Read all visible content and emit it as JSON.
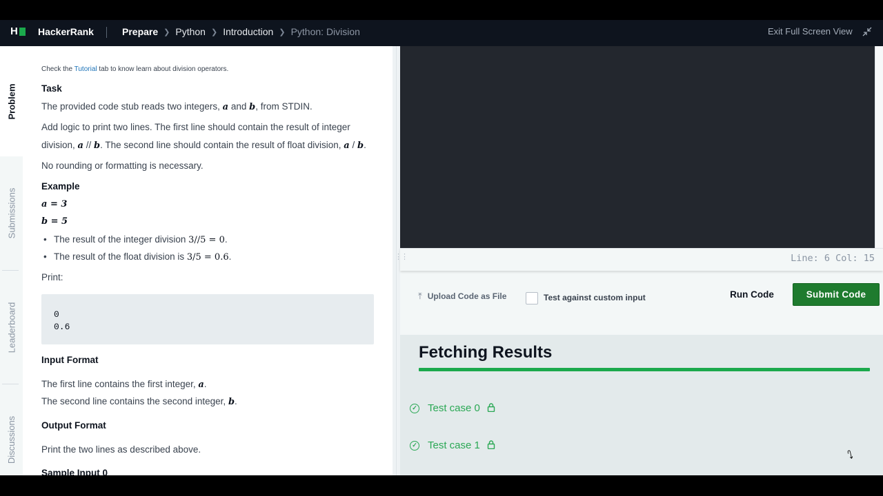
{
  "header": {
    "brand": "HackerRank",
    "breadcrumbs": [
      "Prepare",
      "Python",
      "Introduction",
      "Python: Division"
    ],
    "exit_fullscreen": "Exit Full Screen View",
    "icons": {
      "logo": "hackerrank-logo",
      "shrink": "shrink-icon",
      "chevron": "chevron-right-icon"
    }
  },
  "sidebar": {
    "tabs": [
      {
        "label": "Problem",
        "active": true
      },
      {
        "label": "Submissions",
        "active": false
      },
      {
        "label": "Leaderboard",
        "active": false
      },
      {
        "label": "Discussions",
        "active": false
      }
    ]
  },
  "problem": {
    "intro_pre": "Check the ",
    "intro_link": "Tutorial",
    "intro_post": " tab to know learn about division operators.",
    "task_heading": "Task",
    "task_p1_a": "The provided code stub reads two integers, ",
    "var_a": "a",
    "and": " and ",
    "var_b": "b",
    "task_p1_b": ", from STDIN.",
    "task_p2_line1": "Add logic to print two lines. The first line should contain the result of integer",
    "task_p2_line2_a": "division, ",
    "intdiv_op": " // ",
    "task_p2_line2_b": ". The second line should contain the result of float division, ",
    "floatdiv_op": " / ",
    "period": ".",
    "task_p3": "No rounding or formatting is necessary.",
    "example_heading": "Example",
    "example_a": "a = 3",
    "example_b": "b = 5",
    "bullet1_text": "The result of the integer division ",
    "bullet1_math": "3//5 = 0",
    "bullet2_text": "The result of the float division is ",
    "bullet2_math": "3/5 = 0.6",
    "print_label": "Print:",
    "output_line1": "0",
    "output_line2": "0.6",
    "input_format_heading": "Input Format",
    "input_line1": "The first line contains the first integer, ",
    "input_line2": "The second line contains the second integer, ",
    "output_format_heading": "Output Format",
    "output_format_text": "Print the two lines as described above.",
    "sample_input_heading": "Sample Input 0"
  },
  "editor": {
    "status": "Line: 6 Col: 15"
  },
  "actions": {
    "upload_label": "Upload Code as File",
    "custom_input_label": "Test against custom input",
    "custom_input_checked": false,
    "run_label": "Run Code",
    "submit_label": "Submit Code"
  },
  "results": {
    "heading": "Fetching Results",
    "progress_percent": 100,
    "test_cases": [
      {
        "label": "Test case 0",
        "status": "passed",
        "locked": true
      },
      {
        "label": "Test case 1",
        "status": "passed",
        "locked": true
      }
    ]
  },
  "colors": {
    "topbar": "#0e141e",
    "accent_green": "#1ba94c",
    "submit_green": "#1e7b2e",
    "editor_bg": "#23272e",
    "link_blue": "#1d73b8"
  }
}
